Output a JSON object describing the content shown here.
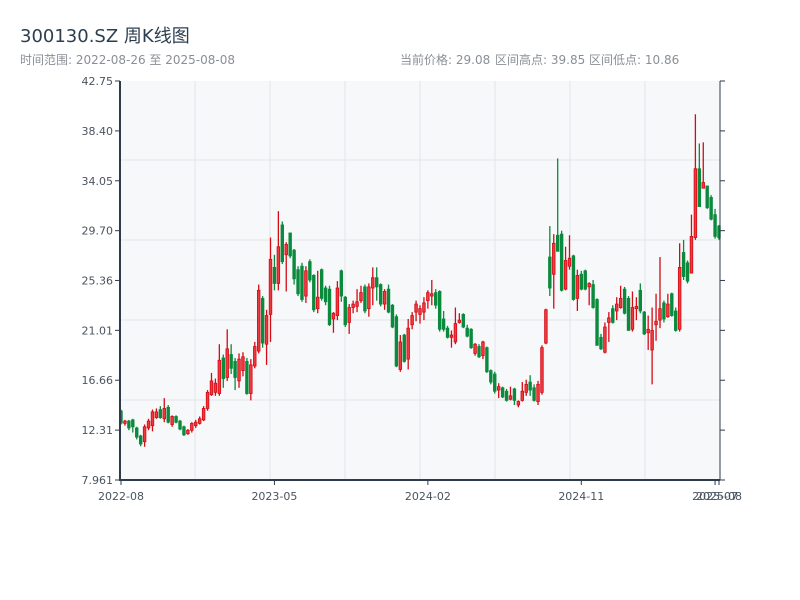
{
  "header": {
    "title": "300130.SZ 周K线图",
    "range_label": "时间范围: 2022-08-26 至 2025-08-08",
    "current_price_label": "当前价格: 29.08",
    "high_label": "区间高点: 39.85",
    "low_label": "区间低点: 10.86"
  },
  "colors": {
    "up": "#d40a14",
    "up_fill": "#ec3a40",
    "down": "#0a8a3c",
    "plot_bg": "#f7f8fa",
    "axis": "#2e3b4c",
    "grid": "#e1e4ea"
  },
  "chart_data": {
    "type": "candlestick",
    "title": "300130.SZ 周K线图",
    "period": "weekly",
    "date_range": [
      "2022-08-26",
      "2025-08-08"
    ],
    "ylim": [
      7.961,
      42.75
    ],
    "y_ticks": [
      "42.75",
      "38.40",
      "34.05",
      "29.70",
      "25.36",
      "21.01",
      "16.66",
      "12.31",
      "7.961"
    ],
    "x_ticks": [
      {
        "label": "2022-08",
        "index": 0
      },
      {
        "label": "2023-05",
        "index": 39
      },
      {
        "label": "2024-02",
        "index": 78
      },
      {
        "label": "2024-11",
        "index": 117
      },
      {
        "label": "2025-07",
        "index": 151
      },
      {
        "label": "2025-08",
        "index": 152
      }
    ],
    "grid": true,
    "ohlc_fields": [
      "open",
      "high",
      "low",
      "close"
    ],
    "ohlc": [
      [
        13.98,
        14.1,
        12.8,
        12.93
      ],
      [
        12.9,
        13.2,
        12.7,
        13.1
      ],
      [
        13.1,
        13.2,
        12.3,
        12.5
      ],
      [
        13.2,
        13.3,
        12.1,
        12.6
      ],
      [
        12.5,
        12.6,
        11.5,
        11.7
      ],
      [
        11.8,
        11.9,
        10.9,
        11.1
      ],
      [
        11.3,
        12.8,
        10.86,
        12.6
      ],
      [
        12.5,
        13.3,
        12.3,
        13.1
      ],
      [
        12.7,
        14.1,
        12.2,
        13.9
      ],
      [
        13.4,
        14.2,
        13.3,
        13.9
      ],
      [
        14.1,
        14.4,
        13.3,
        13.4
      ],
      [
        13.3,
        15.1,
        13.0,
        14.2
      ],
      [
        14.3,
        14.5,
        12.9,
        13.0
      ],
      [
        12.8,
        13.6,
        12.6,
        13.5
      ],
      [
        13.5,
        13.6,
        12.9,
        13.0
      ],
      [
        13.1,
        13.2,
        12.3,
        12.4
      ],
      [
        12.6,
        12.7,
        11.8,
        11.9
      ],
      [
        12.0,
        12.4,
        11.9,
        12.3
      ],
      [
        12.3,
        13.0,
        12.1,
        12.9
      ],
      [
        12.7,
        13.2,
        12.5,
        13.0
      ],
      [
        12.9,
        13.5,
        12.8,
        13.3
      ],
      [
        13.2,
        14.4,
        13.1,
        14.2
      ],
      [
        14.2,
        15.8,
        14.0,
        15.6
      ],
      [
        15.4,
        17.3,
        15.3,
        16.6
      ],
      [
        15.6,
        16.8,
        15.3,
        16.4
      ],
      [
        15.5,
        19.8,
        15.3,
        18.4
      ],
      [
        18.6,
        18.9,
        16.0,
        16.8
      ],
      [
        16.9,
        21.1,
        16.6,
        19.4
      ],
      [
        18.9,
        19.8,
        17.2,
        17.7
      ],
      [
        18.3,
        18.6,
        15.8,
        16.9
      ],
      [
        16.6,
        19.0,
        16.0,
        18.5
      ],
      [
        17.5,
        19.1,
        17.0,
        18.7
      ],
      [
        18.3,
        18.6,
        15.4,
        15.5
      ],
      [
        15.5,
        18.5,
        14.9,
        18.0
      ],
      [
        17.9,
        20.0,
        17.7,
        19.6
      ],
      [
        19.2,
        25.0,
        19.0,
        24.5
      ],
      [
        23.8,
        24.0,
        19.5,
        19.9
      ],
      [
        19.8,
        22.8,
        18.0,
        22.3
      ],
      [
        22.4,
        29.1,
        20.0,
        27.2
      ],
      [
        26.5,
        27.6,
        24.5,
        25.1
      ],
      [
        25.1,
        31.4,
        24.5,
        28.3
      ],
      [
        30.2,
        30.5,
        26.8,
        27.0
      ],
      [
        27.6,
        28.7,
        24.4,
        28.5
      ],
      [
        29.5,
        29.5,
        27.3,
        27.5
      ],
      [
        28.0,
        28.1,
        25.0,
        25.5
      ],
      [
        26.3,
        26.6,
        24.0,
        24.2
      ],
      [
        26.6,
        26.9,
        23.5,
        23.7
      ],
      [
        24.0,
        26.6,
        23.4,
        26.2
      ],
      [
        27.0,
        27.2,
        25.2,
        25.4
      ],
      [
        25.8,
        25.9,
        22.6,
        22.8
      ],
      [
        22.9,
        26.2,
        22.5,
        23.9
      ],
      [
        26.3,
        26.4,
        23.6,
        23.8
      ],
      [
        24.7,
        24.9,
        23.2,
        23.5
      ],
      [
        24.6,
        24.9,
        21.4,
        21.5
      ],
      [
        22.0,
        22.6,
        20.8,
        22.5
      ],
      [
        22.3,
        25.3,
        21.9,
        24.7
      ],
      [
        26.2,
        26.3,
        23.5,
        24.0
      ],
      [
        23.9,
        24.0,
        21.3,
        21.5
      ],
      [
        21.7,
        23.3,
        20.7,
        23.0
      ],
      [
        23.0,
        23.6,
        22.5,
        23.3
      ],
      [
        23.1,
        24.6,
        22.6,
        23.5
      ],
      [
        23.6,
        24.9,
        23.4,
        24.3
      ],
      [
        24.8,
        25.0,
        22.5,
        22.7
      ],
      [
        22.9,
        25.1,
        22.2,
        24.8
      ],
      [
        24.7,
        26.5,
        23.2,
        25.6
      ],
      [
        25.6,
        26.5,
        23.6,
        24.8
      ],
      [
        25.0,
        25.1,
        23.1,
        23.3
      ],
      [
        23.3,
        24.6,
        22.8,
        24.4
      ],
      [
        24.6,
        25.0,
        22.5,
        22.6
      ],
      [
        23.2,
        23.3,
        21.2,
        21.3
      ],
      [
        22.2,
        22.4,
        17.8,
        17.9
      ],
      [
        17.6,
        20.6,
        17.4,
        20.0
      ],
      [
        20.6,
        20.7,
        18.2,
        18.3
      ],
      [
        18.5,
        22.0,
        17.6,
        21.2
      ],
      [
        21.5,
        22.6,
        21.1,
        22.3
      ],
      [
        22.6,
        23.6,
        21.8,
        23.3
      ],
      [
        22.4,
        23.2,
        21.6,
        22.9
      ],
      [
        22.6,
        23.9,
        21.9,
        23.4
      ],
      [
        23.6,
        24.5,
        22.9,
        24.3
      ],
      [
        24.0,
        25.4,
        23.2,
        24.2
      ],
      [
        24.3,
        24.6,
        22.9,
        23.2
      ],
      [
        24.4,
        24.5,
        20.9,
        21.1
      ],
      [
        22.0,
        22.7,
        20.9,
        21.1
      ],
      [
        21.2,
        21.4,
        20.3,
        20.4
      ],
      [
        20.4,
        21.0,
        19.5,
        20.6
      ],
      [
        20.0,
        23.0,
        19.8,
        21.6
      ],
      [
        21.7,
        22.5,
        21.6,
        21.9
      ],
      [
        22.4,
        22.5,
        21.2,
        21.3
      ],
      [
        21.2,
        21.5,
        20.4,
        20.5
      ],
      [
        21.1,
        21.2,
        19.4,
        19.5
      ],
      [
        19.0,
        19.9,
        18.8,
        19.8
      ],
      [
        19.6,
        19.8,
        18.6,
        18.7
      ],
      [
        18.8,
        20.1,
        18.5,
        20.0
      ],
      [
        19.5,
        19.6,
        17.3,
        17.4
      ],
      [
        17.5,
        17.6,
        16.3,
        16.5
      ],
      [
        17.2,
        17.4,
        15.5,
        15.7
      ],
      [
        15.8,
        16.4,
        15.1,
        16.1
      ],
      [
        16.0,
        16.1,
        15.1,
        15.2
      ],
      [
        15.7,
        15.9,
        14.8,
        14.9
      ],
      [
        15.0,
        16.1,
        14.9,
        15.3
      ],
      [
        15.9,
        16.0,
        14.5,
        14.9
      ],
      [
        14.5,
        14.9,
        14.3,
        14.8
      ],
      [
        14.9,
        16.5,
        14.8,
        15.7
      ],
      [
        15.6,
        16.7,
        15.3,
        16.3
      ],
      [
        16.5,
        17.1,
        15.3,
        15.8
      ],
      [
        16.0,
        16.3,
        14.8,
        14.9
      ],
      [
        14.8,
        16.6,
        14.5,
        16.3
      ],
      [
        15.6,
        19.7,
        15.4,
        19.5
      ],
      [
        19.9,
        22.9,
        19.8,
        22.8
      ],
      [
        27.4,
        30.1,
        24.0,
        24.7
      ],
      [
        25.9,
        29.4,
        22.9,
        28.6
      ],
      [
        29.3,
        36.0,
        27.9,
        27.9
      ],
      [
        29.4,
        29.7,
        24.4,
        24.5
      ],
      [
        24.6,
        28.3,
        24.5,
        27.1
      ],
      [
        26.6,
        29.3,
        26.3,
        27.3
      ],
      [
        27.5,
        27.6,
        23.6,
        23.7
      ],
      [
        23.8,
        26.3,
        22.7,
        25.8
      ],
      [
        25.9,
        26.2,
        24.5,
        24.6
      ],
      [
        26.2,
        26.3,
        24.5,
        24.6
      ],
      [
        24.8,
        25.2,
        23.2,
        25.1
      ],
      [
        25.0,
        25.4,
        22.9,
        23.0
      ],
      [
        23.7,
        23.8,
        19.7,
        19.7
      ],
      [
        20.4,
        20.7,
        19.3,
        19.4
      ],
      [
        19.1,
        21.7,
        19.0,
        21.3
      ],
      [
        21.7,
        22.6,
        20.0,
        22.1
      ],
      [
        22.9,
        23.2,
        21.6,
        21.7
      ],
      [
        22.7,
        23.9,
        21.9,
        23.3
      ],
      [
        23.0,
        24.9,
        22.9,
        23.8
      ],
      [
        24.6,
        24.8,
        22.4,
        22.5
      ],
      [
        23.8,
        24.0,
        21.0,
        21.0
      ],
      [
        21.1,
        24.4,
        20.9,
        23.0
      ],
      [
        22.9,
        23.9,
        21.9,
        23.1
      ],
      [
        24.5,
        25.1,
        22.5,
        22.7
      ],
      [
        22.6,
        22.7,
        20.6,
        20.7
      ],
      [
        20.8,
        22.3,
        19.3,
        21.1
      ],
      [
        19.3,
        23.0,
        16.3,
        21.0
      ],
      [
        21.5,
        24.2,
        20.1,
        21.8
      ],
      [
        21.9,
        27.4,
        21.2,
        22.9
      ],
      [
        23.4,
        23.6,
        21.7,
        22.0
      ],
      [
        22.2,
        24.2,
        22.1,
        23.3
      ],
      [
        24.2,
        24.3,
        22.2,
        22.3
      ],
      [
        22.7,
        23.0,
        20.9,
        21.0
      ],
      [
        21.1,
        28.6,
        20.9,
        26.5
      ],
      [
        27.8,
        28.9,
        25.4,
        25.7
      ],
      [
        26.9,
        27.1,
        25.1,
        25.3
      ],
      [
        26.0,
        31.1,
        26.0,
        29.2
      ],
      [
        29.1,
        39.85,
        28.9,
        35.1
      ],
      [
        35.1,
        37.3,
        31.8,
        31.8
      ],
      [
        33.4,
        37.4,
        33.4,
        33.9
      ],
      [
        33.6,
        33.6,
        31.6,
        31.7
      ],
      [
        32.6,
        32.8,
        30.6,
        30.7
      ],
      [
        31.1,
        31.6,
        29.0,
        29.2
      ],
      [
        30.1,
        30.2,
        28.9,
        29.08
      ]
    ]
  }
}
